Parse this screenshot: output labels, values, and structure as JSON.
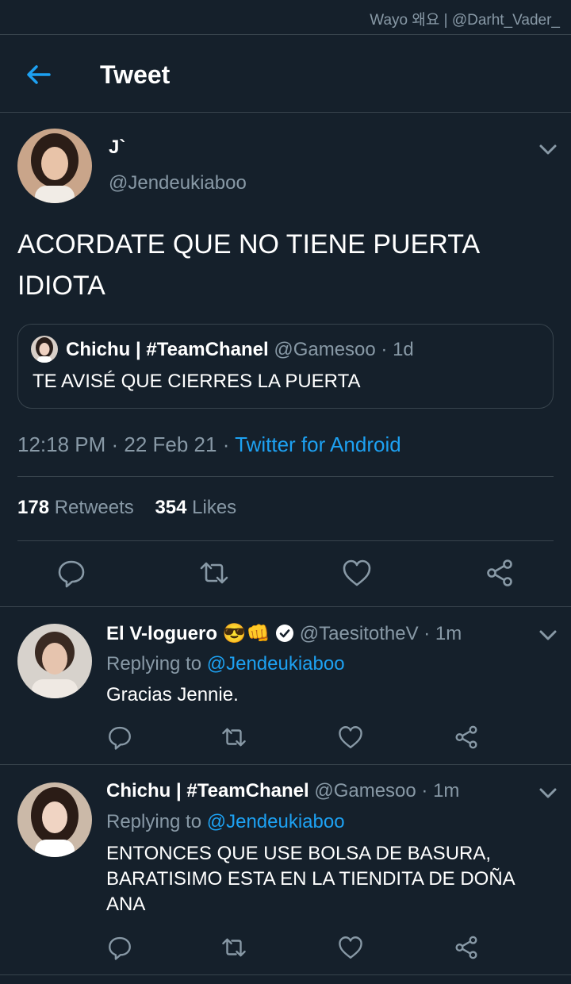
{
  "watermark": "Wayo 왜요 | @Darht_Vader_",
  "header": {
    "title": "Tweet"
  },
  "tweet": {
    "author_name": "J`",
    "author_handle": "@Jendeukiaboo",
    "text": "ACORDATE QUE NO TIENE PUERTA IDIOTA",
    "quote": {
      "name": "Chichu | #TeamChanel",
      "handle": "@Gamesoo",
      "time": "· 1d",
      "text": "TE AVISÉ QUE CIERRES LA PUERTA"
    },
    "timestamp": "12:18 PM · 22 Feb 21 ·",
    "source": "Twitter for Android",
    "retweets_count": "178",
    "retweets_label": "Retweets",
    "likes_count": "354",
    "likes_label": "Likes"
  },
  "replies": [
    {
      "name": "El V-loguero",
      "emoji": "😎👊",
      "handle": "@TaesitotheV",
      "time": "· 1m",
      "replying_label": "Replying to",
      "replying_to": "@Jendeukiaboo",
      "text": "Gracias Jennie."
    },
    {
      "name": "Chichu | #TeamChanel",
      "handle": "@Gamesoo",
      "time": "· 1m",
      "replying_label": "Replying to",
      "replying_to": "@Jendeukiaboo",
      "text": "ENTONCES QUE USE BOLSA DE BASURA, BARATISIMO ESTA EN LA TIENDITA DE DOÑA ANA"
    }
  ],
  "icons": {
    "back": "back-arrow-icon",
    "more": "chevron-down-icon",
    "reply": "reply-icon",
    "retweet": "retweet-icon",
    "like": "heart-icon",
    "share": "share-icon",
    "verified": "verified-badge-icon"
  },
  "colors": {
    "background": "#15202b",
    "accent": "#1da1f2",
    "muted": "#8899a6",
    "divider": "#38444d"
  }
}
